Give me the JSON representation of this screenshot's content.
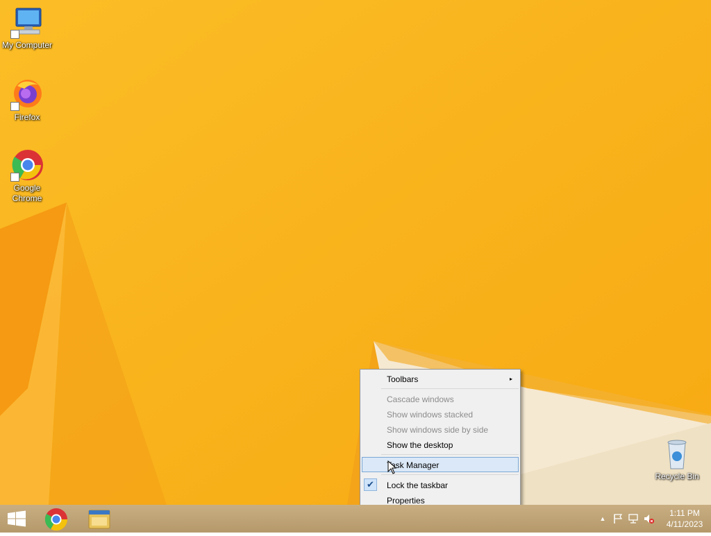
{
  "desktop": {
    "icons": [
      {
        "label": "My Computer"
      },
      {
        "label": "Firefox"
      },
      {
        "label": "Google Chrome"
      },
      {
        "label": "Recycle Bin"
      }
    ]
  },
  "context_menu": {
    "items": [
      {
        "label": "Toolbars",
        "has_submenu": true
      },
      {
        "label": "Cascade windows",
        "disabled": true
      },
      {
        "label": "Show windows stacked",
        "disabled": true
      },
      {
        "label": "Show windows side by side",
        "disabled": true
      },
      {
        "label": "Show the desktop"
      },
      {
        "label": "Task Manager",
        "highlighted": true
      },
      {
        "label": "Lock the taskbar",
        "checked": true
      },
      {
        "label": "Properties"
      }
    ],
    "submenu_arrow": "▸",
    "check_glyph": "✔"
  },
  "taskbar": {
    "buttons": [
      {
        "icon": "windows-logo-icon"
      },
      {
        "icon": "chrome-icon"
      },
      {
        "icon": "file-explorer-icon"
      }
    ],
    "tray": {
      "show_hidden_glyph": "▲",
      "time": "1:11 PM",
      "date": "4/11/2023"
    }
  },
  "colors": {
    "wallpaper": "#f9b21a",
    "taskbar": "#b8a077",
    "menu_highlight": "#dbe8f7"
  }
}
